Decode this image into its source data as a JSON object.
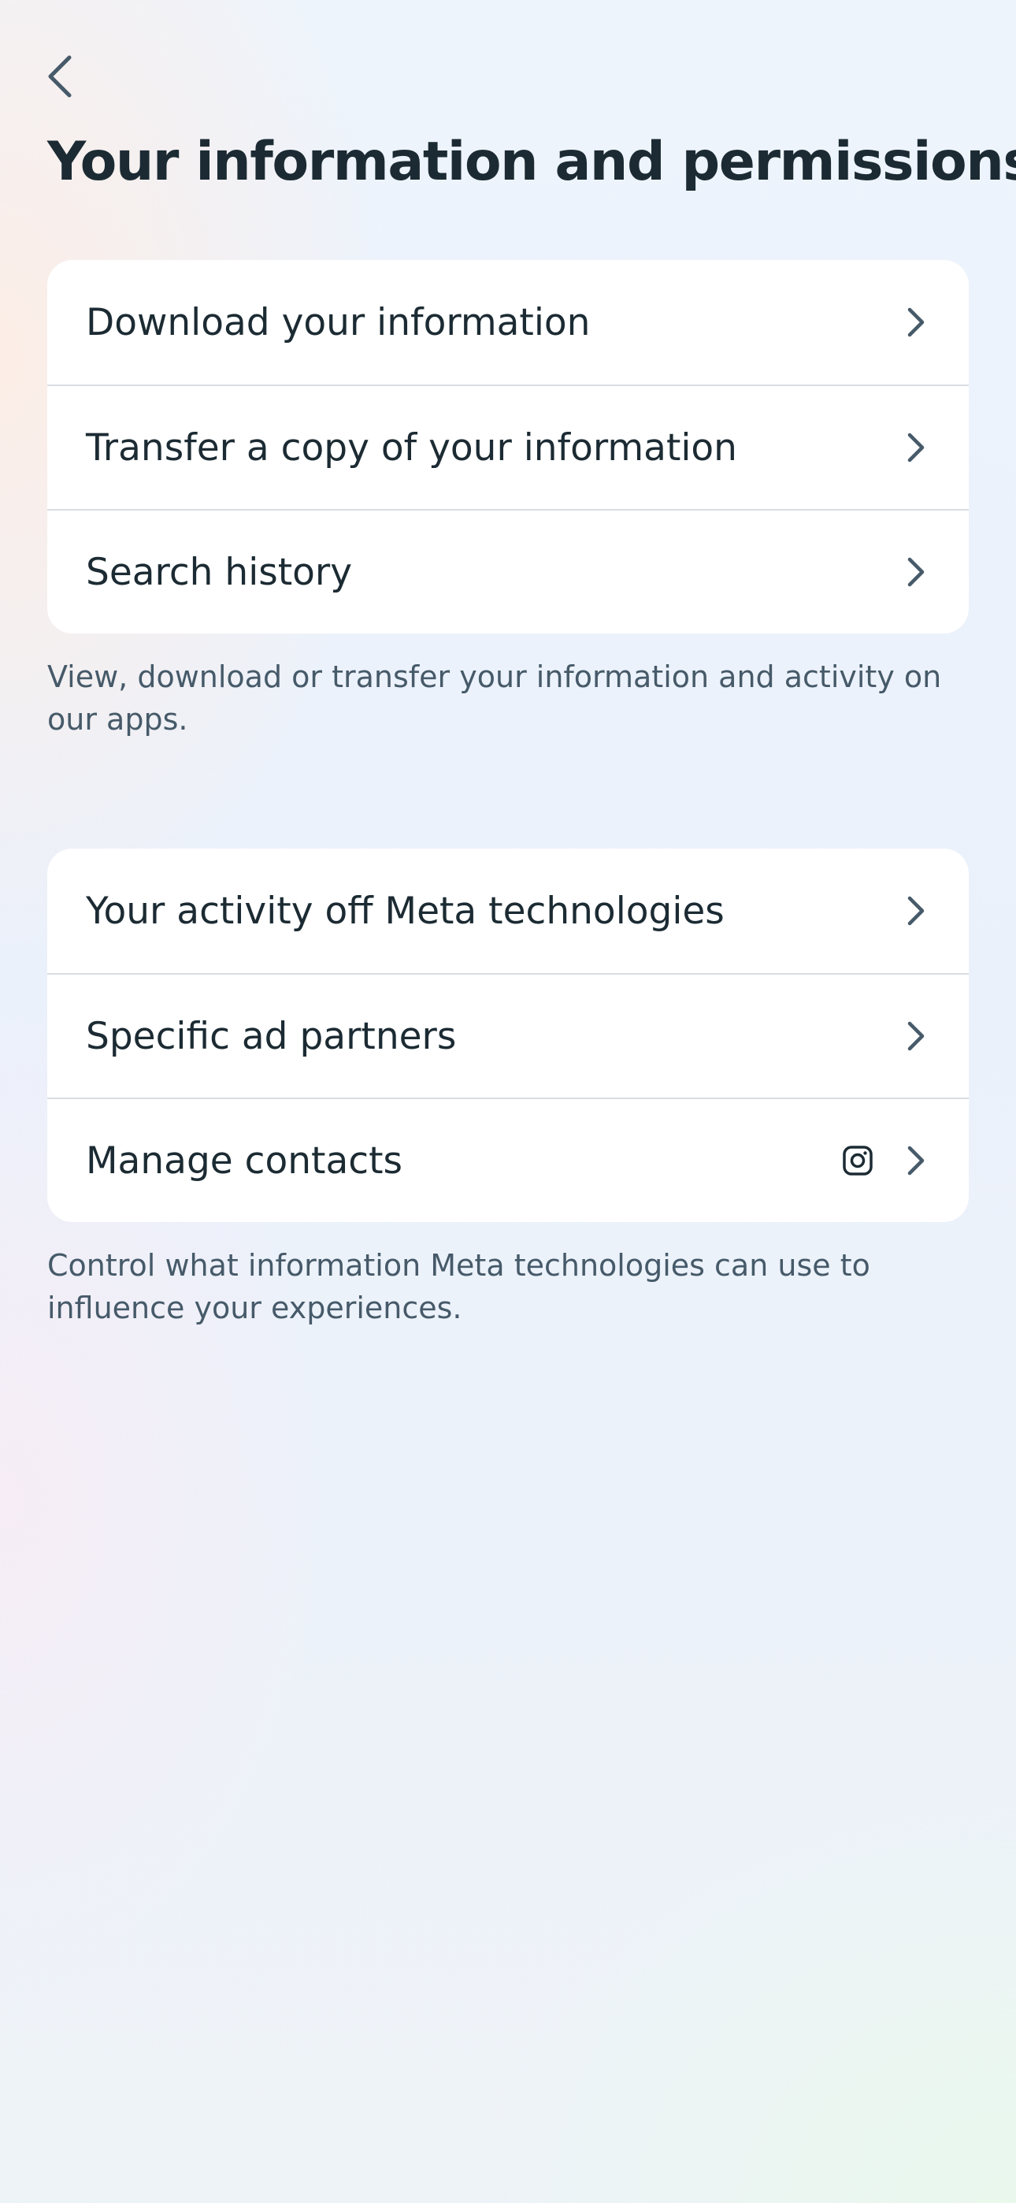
{
  "header": {
    "back_icon": "chevron-left-icon",
    "title": "Your information and permissions"
  },
  "sections": [
    {
      "items": [
        {
          "label": "Download your information",
          "icon": "chevron-right-icon"
        },
        {
          "label": "Transfer a copy of your information",
          "icon": "chevron-right-icon"
        },
        {
          "label": "Search history",
          "icon": "chevron-right-icon"
        }
      ],
      "caption": "View, download or transfer your information and activity on our apps."
    },
    {
      "items": [
        {
          "label": "Your activity off Meta technologies",
          "icon": "chevron-right-icon"
        },
        {
          "label": "Specific ad partners",
          "icon": "chevron-right-icon"
        },
        {
          "label": "Manage contacts",
          "icon": "chevron-right-icon",
          "app_icon": "instagram-icon"
        }
      ],
      "caption": "Control what information Meta technologies can use to influence your experiences."
    }
  ],
  "colors": {
    "text_primary": "#1c2b33",
    "text_secondary": "#465a69",
    "card_background": "#ffffff",
    "divider": "#d8dde2"
  }
}
